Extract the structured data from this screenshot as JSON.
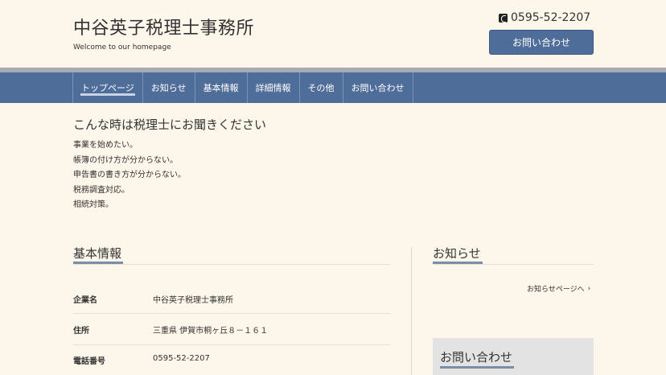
{
  "header": {
    "site_title": "中谷英子税理士事務所",
    "site_description": "Welcome to our homepage",
    "phone": "0595-52-2207",
    "contact_button": "お問い合わせ"
  },
  "nav": {
    "items": [
      {
        "label": "トップページ",
        "active": true
      },
      {
        "label": "お知らせ"
      },
      {
        "label": "基本情報"
      },
      {
        "label": "詳細情報"
      },
      {
        "label": "その他"
      },
      {
        "label": "お問い合わせ"
      }
    ]
  },
  "intro": {
    "title": "こんな時は税理士にお聞きください",
    "lines": [
      "事業を始めたい。",
      "帳簿の付け方が分からない。",
      "申告書の書き方が分からない。",
      "税務調査対応。",
      "相続対策。"
    ]
  },
  "basic_info": {
    "title": "基本情報",
    "rows": [
      {
        "label": "企業名",
        "value": "中谷英子税理士事務所"
      },
      {
        "label": "住所",
        "value": "三重県 伊賀市桐ヶ丘８－１６１"
      },
      {
        "label": "電話番号",
        "value": "0595-52-2207"
      }
    ]
  },
  "news": {
    "title": "お知らせ",
    "link": "お知らせページへ"
  },
  "contact_box": {
    "title": "お問い合わせ"
  },
  "colors": {
    "background": "#fdf6ea",
    "nav": "#4f6d99",
    "accent_underline": "#7b8ea9"
  }
}
